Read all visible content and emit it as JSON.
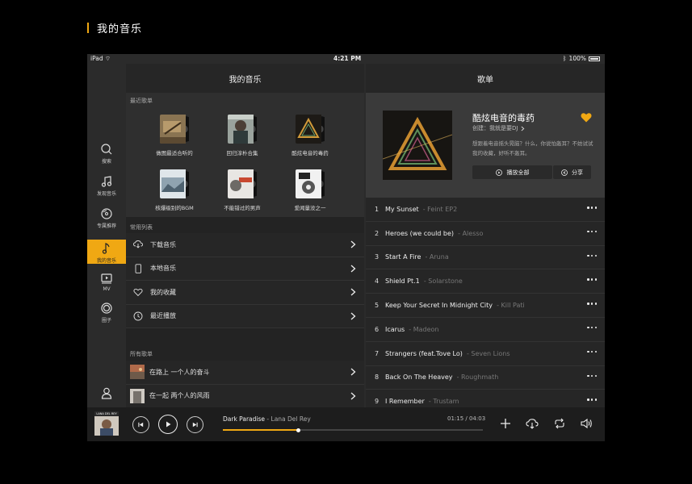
{
  "page_title": "我的音乐",
  "status": {
    "device": "iPad",
    "time": "4:21 PM",
    "battery": "100%"
  },
  "sidebar": {
    "items": [
      {
        "label": "搜索",
        "icon": "search-icon"
      },
      {
        "label": "发现音乐",
        "icon": "music-note-icon"
      },
      {
        "label": "专属推荐",
        "icon": "disc-icon"
      },
      {
        "label": "我的音乐",
        "icon": "music-note-icon",
        "active": true
      },
      {
        "label": "MV",
        "icon": "video-icon"
      },
      {
        "label": "圈子",
        "icon": "circle-icon"
      }
    ]
  },
  "left": {
    "title": "我的音乐",
    "recent_label": "最近歌单",
    "recent": [
      {
        "name": "做图最适合听的"
      },
      {
        "name": "回归淳朴合集"
      },
      {
        "name": "酷炫电音的毒药"
      },
      {
        "name": "核爆级别的BGM"
      },
      {
        "name": "不能错过的男声"
      },
      {
        "name": "爱闻量没之一"
      }
    ],
    "common_label": "常用列表",
    "common": [
      {
        "label": "下载音乐",
        "icon": "cloud-download-icon"
      },
      {
        "label": "本地音乐",
        "icon": "phone-icon"
      },
      {
        "label": "我的收藏",
        "icon": "heart-icon"
      },
      {
        "label": "最近播放",
        "icon": "clock-icon"
      }
    ],
    "all_label": "所有歌单",
    "all": [
      {
        "label": "在路上 一个人的奋斗"
      },
      {
        "label": "在一起 两个人的风雨"
      }
    ]
  },
  "right": {
    "title": "歌单",
    "playlist_title": "酷炫电音的毒药",
    "creator": "创建：我就是要DJ",
    "description": "想跟着电音摇头晃脑？什么，你说怕轰耳？不妨试试我的收藏，好听不轰耳。",
    "play_all": "播放全部",
    "share": "分享",
    "songs": [
      {
        "num": "1",
        "title": "My Sunset",
        "artist": "- Feint EP2"
      },
      {
        "num": "2",
        "title": "Heroes (we could be)",
        "artist": "- Alesso"
      },
      {
        "num": "3",
        "title": "Start A Fire",
        "artist": "- Aruna"
      },
      {
        "num": "4",
        "title": "Shield Pt.1",
        "artist": "- Solarstone"
      },
      {
        "num": "5",
        "title": "Keep Your Secret In Midnight City",
        "artist": "- Kill Pati"
      },
      {
        "num": "6",
        "title": "Icarus",
        "artist": "- Madeon"
      },
      {
        "num": "7",
        "title": "Strangers (feat.Tove Lo)",
        "artist": "- Seven Lions"
      },
      {
        "num": "8",
        "title": "Back On The Heavey",
        "artist": "- Roughmath"
      },
      {
        "num": "9",
        "title": "I Remember",
        "artist": "- Trustam"
      }
    ]
  },
  "player": {
    "title": "Dark Paradise",
    "sep": "-",
    "artist": "Lana Del Rey",
    "time": "01:15 / 04:03",
    "progress": 0.29,
    "cover_text": "LANA DEL REY"
  },
  "colors": {
    "accent": "#f0a813"
  }
}
